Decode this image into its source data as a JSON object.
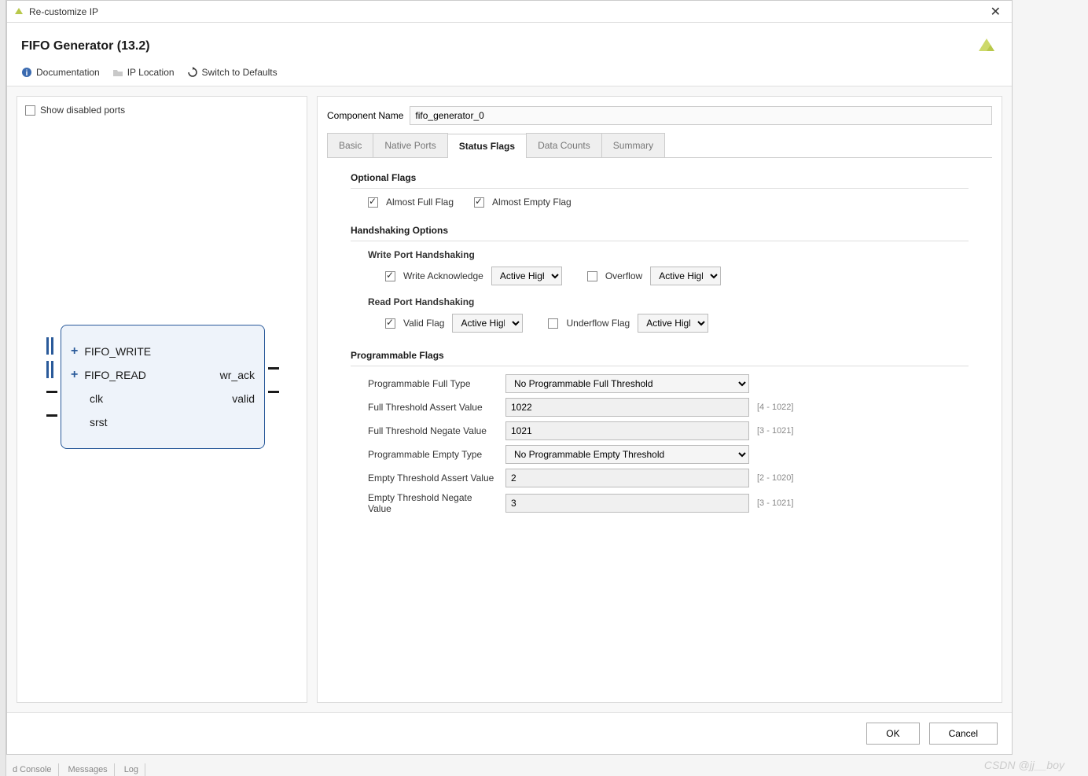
{
  "window": {
    "title": "Re-customize IP",
    "heading": "FIFO Generator (13.2)"
  },
  "toolbar": {
    "documentation": "Documentation",
    "ip_location": "IP Location",
    "switch_defaults": "Switch to Defaults"
  },
  "left": {
    "show_disabled": "Show disabled ports",
    "show_disabled_checked": false,
    "ports_in": [
      "FIFO_WRITE",
      "FIFO_READ",
      "clk",
      "srst"
    ],
    "ports_out": [
      "wr_ack",
      "valid"
    ]
  },
  "component": {
    "label": "Component Name",
    "value": "fifo_generator_0"
  },
  "tabs": [
    "Basic",
    "Native Ports",
    "Status Flags",
    "Data Counts",
    "Summary"
  ],
  "active_tab": "Status Flags",
  "optional_flags": {
    "title": "Optional Flags",
    "almost_full": {
      "label": "Almost Full Flag",
      "checked": true
    },
    "almost_empty": {
      "label": "Almost Empty Flag",
      "checked": true
    }
  },
  "handshaking": {
    "title": "Handshaking Options",
    "write": {
      "title": "Write Port Handshaking",
      "ack": {
        "label": "Write Acknowledge",
        "checked": true,
        "value": "Active High"
      },
      "overflow": {
        "label": "Overflow",
        "checked": false,
        "value": "Active High"
      }
    },
    "read": {
      "title": "Read Port Handshaking",
      "valid": {
        "label": "Valid Flag",
        "checked": true,
        "value": "Active High"
      },
      "underflow": {
        "label": "Underflow Flag",
        "checked": false,
        "value": "Active High"
      }
    }
  },
  "prog_flags": {
    "title": "Programmable Flags",
    "rows": [
      {
        "label": "Programmable Full Type",
        "type": "select",
        "value": "No Programmable Full Threshold"
      },
      {
        "label": "Full Threshold Assert Value",
        "type": "input",
        "value": "1022",
        "range": "[4 - 1022]"
      },
      {
        "label": "Full Threshold Negate Value",
        "type": "input",
        "value": "1021",
        "range": "[3 - 1021]"
      },
      {
        "label": "Programmable Empty Type",
        "type": "select",
        "value": "No Programmable Empty Threshold"
      },
      {
        "label": "Empty Threshold Assert Value",
        "type": "input",
        "value": "2",
        "range": "[2 - 1020]"
      },
      {
        "label": "Empty Threshold Negate Value",
        "type": "input",
        "value": "3",
        "range": "[3 - 1021]"
      }
    ]
  },
  "footer": {
    "ok": "OK",
    "cancel": "Cancel"
  },
  "watermark": "CSDN @jj__boy",
  "bottom_tabs": [
    "d Console",
    "Messages",
    "Log"
  ]
}
